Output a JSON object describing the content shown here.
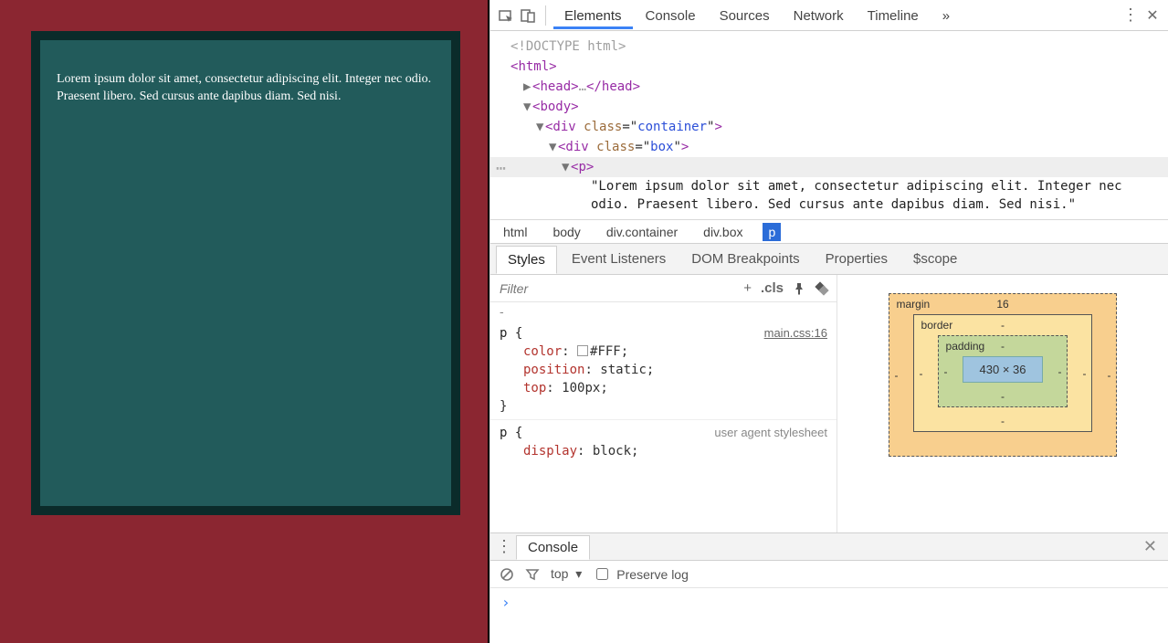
{
  "viewport": {
    "paragraph": "Lorem ipsum dolor sit amet, consectetur adipiscing elit. Integer nec odio. Praesent libero. Sed cursus ante dapibus diam. Sed nisi."
  },
  "toolbar": {
    "tabs": [
      "Elements",
      "Console",
      "Sources",
      "Network",
      "Timeline"
    ],
    "active_tab": "Elements",
    "overflow": "»",
    "menu": "⋮",
    "close": "✕"
  },
  "dom": {
    "doctype": "<!DOCTYPE html>",
    "html_open": "html",
    "head": "head",
    "body": "body",
    "div1_class": "container",
    "div2_class": "box",
    "p": "p",
    "text": "\"Lorem ipsum dolor sit amet, consectetur adipiscing elit. Integer nec odio. Praesent libero. Sed cursus ante dapibus diam. Sed nisi.\""
  },
  "breadcrumbs": [
    "html",
    "body",
    "div.container",
    "div.box",
    "p"
  ],
  "breadcrumbs_active": "p",
  "subtabs": [
    "Styles",
    "Event Listeners",
    "DOM Breakpoints",
    "Properties",
    "$scope"
  ],
  "subtabs_active": "Styles",
  "styles": {
    "filter_placeholder": "Filter",
    "plus": "+",
    "cls": ".cls",
    "rule1": {
      "selector": "p {",
      "source": "main.css:16",
      "props": [
        {
          "name": "color",
          "value": "#FFF",
          "swatch": true
        },
        {
          "name": "position",
          "value": "static"
        },
        {
          "name": "top",
          "value": "100px"
        }
      ],
      "close": "}"
    },
    "rule2": {
      "selector": "p {",
      "source": "user agent stylesheet",
      "props": [
        {
          "name": "display",
          "value": "block"
        }
      ]
    }
  },
  "boxmodel": {
    "margin_label": "margin",
    "border_label": "border",
    "padding_label": "padding",
    "margin_top": "16",
    "dash": "-",
    "content": "430 × 36"
  },
  "drawer": {
    "tab": "Console",
    "menu": "⋮",
    "close": "✕",
    "clear": "⊘",
    "filter": "▽",
    "context": "top",
    "context_arrow": "▾",
    "preserve": "Preserve log",
    "prompt": "›"
  }
}
